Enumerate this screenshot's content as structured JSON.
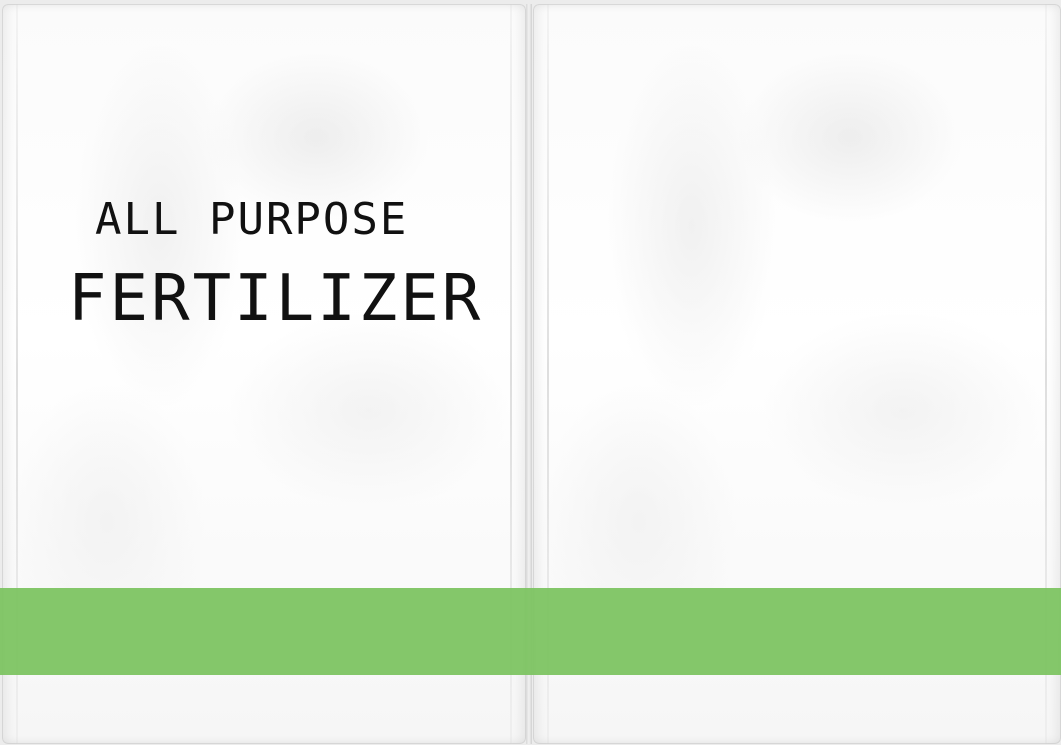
{
  "product": {
    "title_line1": "ALL PURPOSE",
    "title_line2": "FERTILIZER"
  },
  "colors": {
    "band": "#7dc462",
    "text": "#111111",
    "bag": "#ffffff"
  }
}
